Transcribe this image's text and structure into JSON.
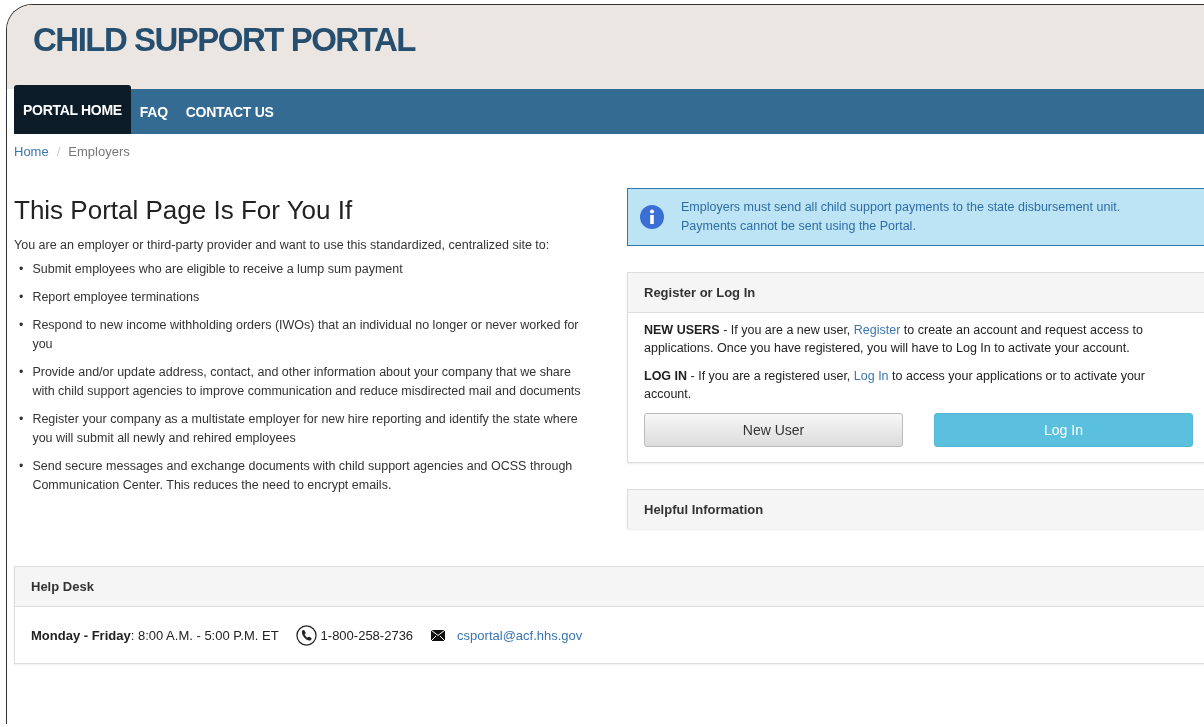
{
  "site_title": "CHILD SUPPORT PORTAL",
  "nav": [
    {
      "label": "PORTAL HOME",
      "selected": true
    },
    {
      "label": "FAQ",
      "selected": false
    },
    {
      "label": "CONTACT US",
      "selected": false
    }
  ],
  "breadcrumb_separator": "/",
  "bullet": "•",
  "breadcrumb": [
    {
      "label": "Home",
      "kind": "link"
    },
    {
      "label": "Employers",
      "kind": "current"
    }
  ],
  "heading": "This Portal Page Is For You If",
  "intro": "You are an employer or third-party provider and want to use this standardized, centralized site to:",
  "bullets": [
    "Submit employees who are eligible to receive a lump sum payment",
    "Report employee terminations",
    "Respond to new income withholding orders (IWOs) that an individual no longer or never worked for you",
    "Provide and/or update address, contact, and other information about your company that we share with child support agencies to improve communication and reduce misdirected mail and documents",
    "Register your company as a multistate employer for new hire reporting and identify the state where you will submit all newly and rehired employees",
    "Send secure messages and exchange documents with child support agencies and OCSS through Communication Center. This reduces the need to encrypt emails."
  ],
  "alert": {
    "text": "Employers must send all child support payments to the state disbursement unit. Payments cannot be sent using the Portal."
  },
  "login_panel": {
    "title": "Register or Log In",
    "paragraphs": [
      [
        {
          "text": "**NEW USERS** - If you are a new user, ",
          "kind": "text"
        },
        {
          "text": "Register",
          "kind": "link"
        },
        {
          "text": " to create an account and request access to applications. Once you have registered, you will have to Log In to activate your account.",
          "kind": "text"
        }
      ],
      [
        {
          "text": "**LOG IN** - If you are a registered user, ",
          "kind": "text"
        },
        {
          "text": "Log In",
          "kind": "link"
        },
        {
          "text": " to access your applications or to activate your account.",
          "kind": "text"
        }
      ]
    ],
    "buttons": [
      {
        "label": "New User",
        "kind": "default"
      },
      {
        "label": "Log In",
        "kind": "primary"
      }
    ]
  },
  "info_panel": {
    "title": "Helpful Information"
  },
  "help_desk": {
    "title": "Help Desk",
    "hours": "**Monday - Friday**: 8:00 A.M. - 5:00 P.M. ET",
    "phone": "1-800-258-2736",
    "email": "csportal@acf.hhs.gov"
  }
}
